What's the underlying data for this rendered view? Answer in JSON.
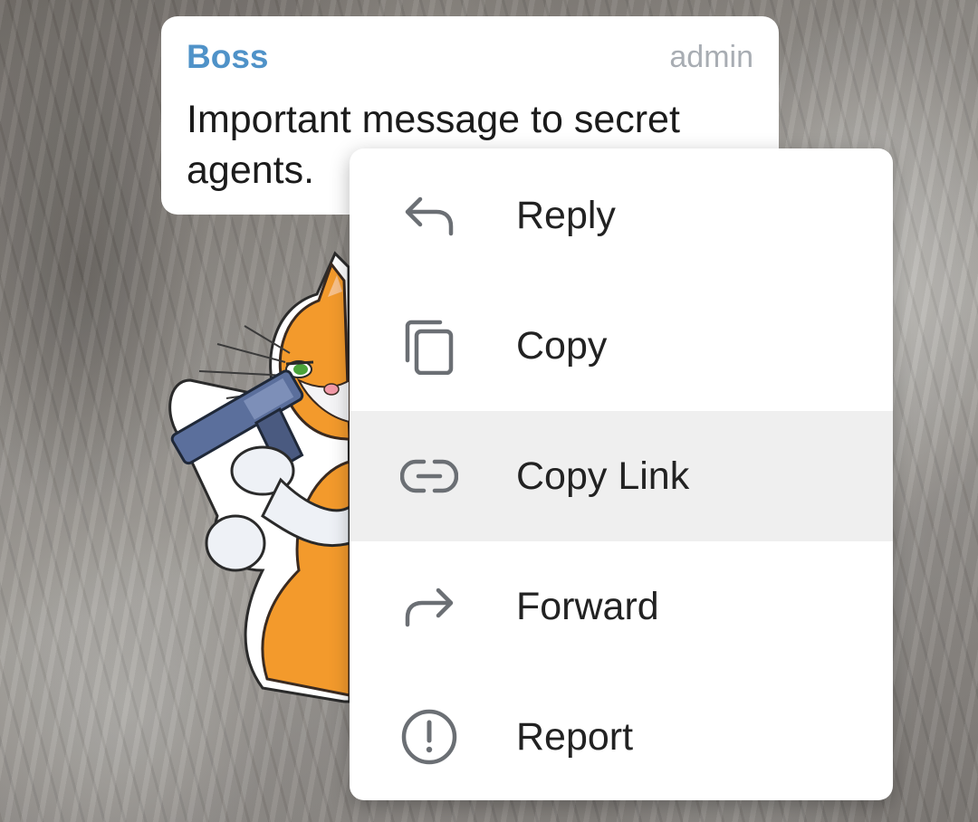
{
  "message": {
    "sender": "Boss",
    "role": "admin",
    "text": "Important message to secret agents."
  },
  "sticker": {
    "icon": "cat-agent-with-pistol-sticker"
  },
  "context_menu": {
    "items": [
      {
        "label": "Reply",
        "icon": "reply-icon",
        "highlighted": false
      },
      {
        "label": "Copy",
        "icon": "copy-icon",
        "highlighted": false
      },
      {
        "label": "Copy Link",
        "icon": "link-icon",
        "highlighted": true
      },
      {
        "label": "Forward",
        "icon": "forward-icon",
        "highlighted": false
      },
      {
        "label": "Report",
        "icon": "report-icon",
        "highlighted": false
      }
    ]
  },
  "colors": {
    "sender_name": "#4f92c8",
    "role": "#a8adb3",
    "menu_icon": "#6b6f74",
    "highlight": "#efefef"
  }
}
